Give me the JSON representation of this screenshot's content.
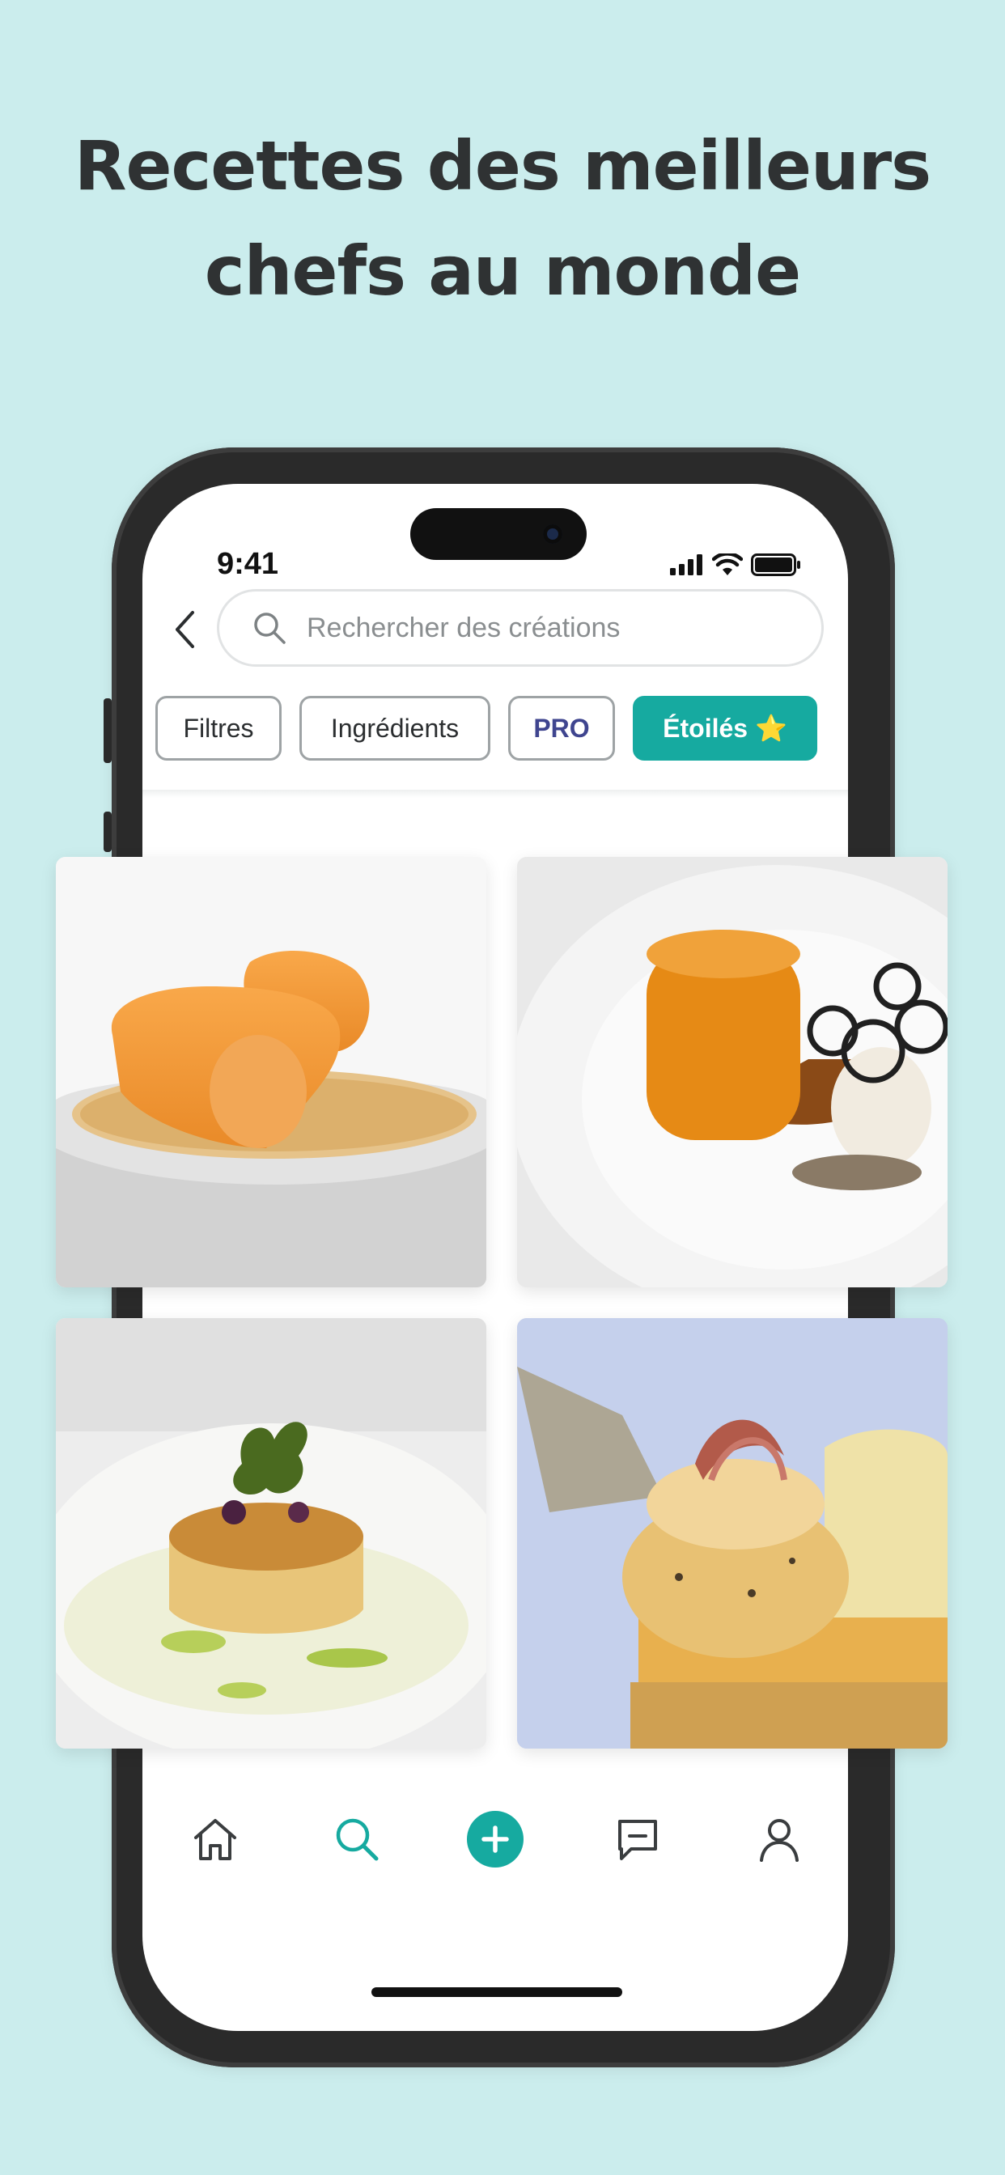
{
  "headline": {
    "line1": "Recettes des meilleurs",
    "line2": "chefs au monde"
  },
  "status_bar": {
    "time": "9:41",
    "icons": [
      "signal-icon",
      "wifi-icon",
      "battery-icon"
    ]
  },
  "search": {
    "placeholder": "Rechercher des créations"
  },
  "filters": [
    {
      "label": "Filtres"
    },
    {
      "label": "Ingrédients"
    },
    {
      "label": "PRO"
    },
    {
      "label": "Étoilés ⭐"
    }
  ],
  "recipes": [
    {
      "image": "dish-carrot-tuiles"
    },
    {
      "image": "dish-glazed-pumpkin"
    },
    {
      "image": "dish-potato-millefeuille"
    },
    {
      "image": "dish-soufflé-ham"
    }
  ],
  "tabbar": {
    "items": [
      "home-icon",
      "search-icon",
      "add-icon",
      "messages-icon",
      "profile-icon"
    ],
    "active": "search-icon"
  },
  "colors": {
    "background": "#cbeded",
    "accent": "#16aaa0",
    "pro": "#3f458f",
    "text": "#2f3233"
  }
}
